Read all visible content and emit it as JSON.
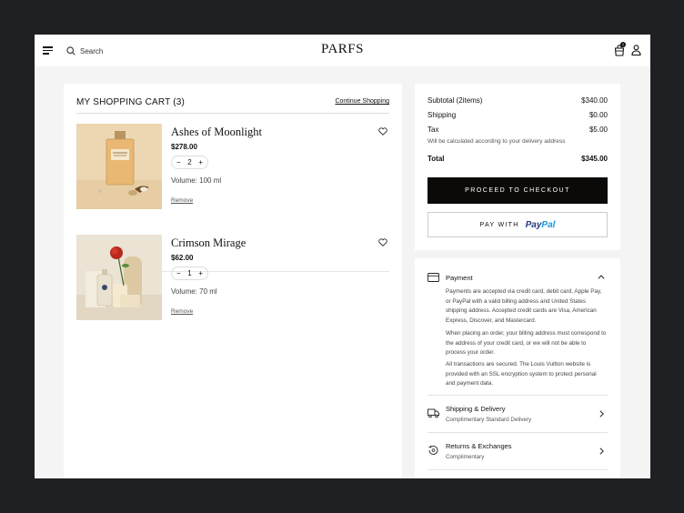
{
  "header": {
    "search_label": "Search",
    "logo": "PARFS",
    "cart_count": "1"
  },
  "cart": {
    "title": "MY SHOPPING CART (3)",
    "continue_label": "Continue Shopping",
    "items": [
      {
        "name": "Ashes of Moonlight",
        "price": "$278.00",
        "qty": "2",
        "volume": "Volume: 100 ml",
        "remove": "Remove",
        "image": "perfume-bottle-image"
      },
      {
        "name": "Crimson Mirage",
        "price": "$62.00",
        "qty": "1",
        "volume": "Volume: 70 ml",
        "remove": "Remove",
        "image": "perfume-rose-image"
      }
    ]
  },
  "summary": {
    "subtotal_label": "Subtotal (2items)",
    "subtotal_value": "$340.00",
    "shipping_label": "Shipping",
    "shipping_value": "$0.00",
    "tax_label": "Tax",
    "tax_value": "$5.00",
    "tax_note": "Will be calculated according to your delivery address",
    "total_label": "Total",
    "total_value": "$345.00",
    "checkout_label": "PROCEED TO CHECKOUT",
    "paypal_label": "PAY WITH",
    "paypal_brand_1": "Pay",
    "paypal_brand_2": "Pal"
  },
  "info": {
    "payment_title": "Payment",
    "para1_l1": "Payments are accepted via credit card, debit card, Apple Pay,",
    "para1_l2": "or PayPal with a valid billing address and United States",
    "para1_l3": "shipping address. Accepted credit cards are Visa, American",
    "para1_l4": "Express, Discover, and Mastercard.",
    "para2_l1": "When placing an order, your billing address must correspond to",
    "para2_l2": "the address of your credit card, or we will not be able to",
    "para2_l3": "process your order.",
    "para3_l1": "All transactions are secured. The Louis Vuitton website is",
    "para3_l2": "provided with an SSL encryption system to protect personal",
    "para3_l3": "and payment data.",
    "shipping_title": "Shipping & Delivery",
    "shipping_sub": "Complimentary Standard Delivery",
    "returns_title": "Returns & Exchanges",
    "returns_sub": "Complimentary"
  },
  "colors": {
    "outer_bg": "#1f2023",
    "page_bg": "#f4f4f4",
    "checkout_bg": "#0c0a08",
    "paypal_dark": "#253b80",
    "paypal_light": "#179bd7"
  }
}
